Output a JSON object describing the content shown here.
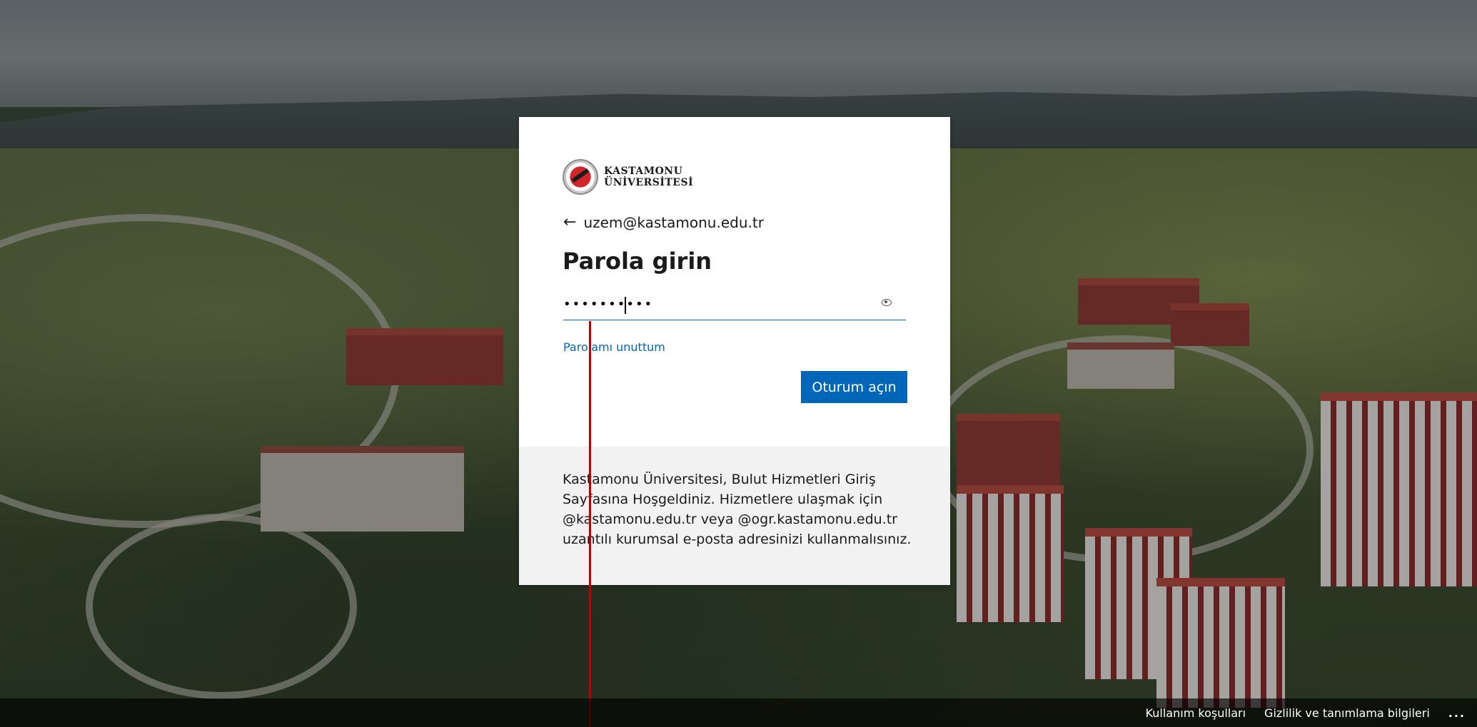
{
  "logo": {
    "line1": "KASTAMONU",
    "line2": "ÜNİVERSİTESİ"
  },
  "identity": {
    "email": "uzem@kastamonu.edu.tr",
    "back_arrow": "←",
    "icon": "back-arrow-icon"
  },
  "title": "Parola girin",
  "password": {
    "value": "••••••••••",
    "reveal_icon": "eye-icon"
  },
  "forgot_link": "Parolamı unuttum",
  "signin_button": "Oturum açın",
  "footer": {
    "text": "Kastamonu Üniversitesi, Bulut Hizmetleri Giriş Sayfasına Hoşgeldiniz. Hizmetlere ulaşmak için @kastamonu.edu.tr veya @ogr.kastamonu.edu.tr uzantılı kurumsal e-posta adresinizi kullanmalısınız."
  },
  "bottom_bar": {
    "terms": "Kullanım koşulları",
    "privacy": "Gizlilik ve tanımlama bilgileri",
    "more": "..."
  },
  "colors": {
    "accent": "#0067b8",
    "annotation": "#c00000"
  }
}
